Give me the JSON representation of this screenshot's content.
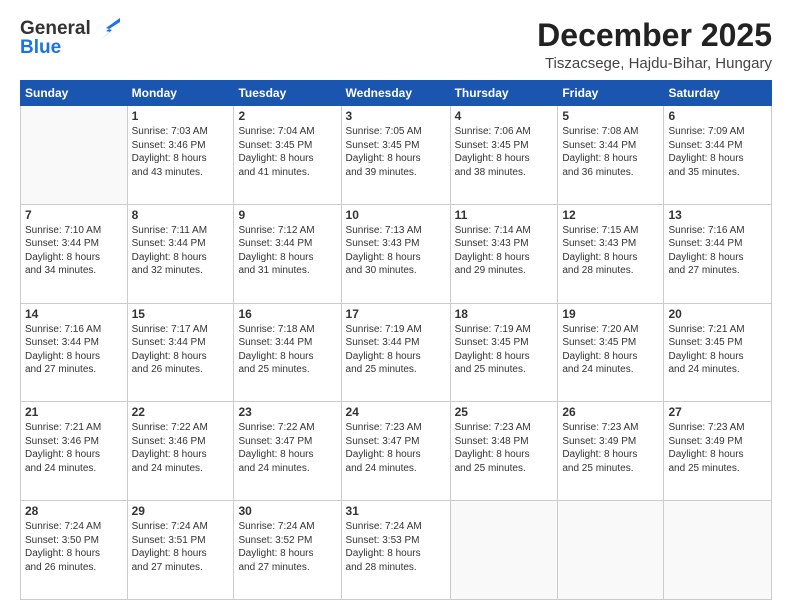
{
  "header": {
    "logo_line1": "General",
    "logo_line2": "Blue",
    "month": "December 2025",
    "location": "Tiszacsege, Hajdu-Bihar, Hungary"
  },
  "days_of_week": [
    "Sunday",
    "Monday",
    "Tuesday",
    "Wednesday",
    "Thursday",
    "Friday",
    "Saturday"
  ],
  "weeks": [
    [
      {
        "day": "",
        "sunrise": "",
        "sunset": "",
        "daylight": ""
      },
      {
        "day": "1",
        "sunrise": "Sunrise: 7:03 AM",
        "sunset": "Sunset: 3:46 PM",
        "daylight": "Daylight: 8 hours and 43 minutes."
      },
      {
        "day": "2",
        "sunrise": "Sunrise: 7:04 AM",
        "sunset": "Sunset: 3:45 PM",
        "daylight": "Daylight: 8 hours and 41 minutes."
      },
      {
        "day": "3",
        "sunrise": "Sunrise: 7:05 AM",
        "sunset": "Sunset: 3:45 PM",
        "daylight": "Daylight: 8 hours and 39 minutes."
      },
      {
        "day": "4",
        "sunrise": "Sunrise: 7:06 AM",
        "sunset": "Sunset: 3:45 PM",
        "daylight": "Daylight: 8 hours and 38 minutes."
      },
      {
        "day": "5",
        "sunrise": "Sunrise: 7:08 AM",
        "sunset": "Sunset: 3:44 PM",
        "daylight": "Daylight: 8 hours and 36 minutes."
      },
      {
        "day": "6",
        "sunrise": "Sunrise: 7:09 AM",
        "sunset": "Sunset: 3:44 PM",
        "daylight": "Daylight: 8 hours and 35 minutes."
      }
    ],
    [
      {
        "day": "7",
        "sunrise": "Sunrise: 7:10 AM",
        "sunset": "Sunset: 3:44 PM",
        "daylight": "Daylight: 8 hours and 34 minutes."
      },
      {
        "day": "8",
        "sunrise": "Sunrise: 7:11 AM",
        "sunset": "Sunset: 3:44 PM",
        "daylight": "Daylight: 8 hours and 32 minutes."
      },
      {
        "day": "9",
        "sunrise": "Sunrise: 7:12 AM",
        "sunset": "Sunset: 3:44 PM",
        "daylight": "Daylight: 8 hours and 31 minutes."
      },
      {
        "day": "10",
        "sunrise": "Sunrise: 7:13 AM",
        "sunset": "Sunset: 3:43 PM",
        "daylight": "Daylight: 8 hours and 30 minutes."
      },
      {
        "day": "11",
        "sunrise": "Sunrise: 7:14 AM",
        "sunset": "Sunset: 3:43 PM",
        "daylight": "Daylight: 8 hours and 29 minutes."
      },
      {
        "day": "12",
        "sunrise": "Sunrise: 7:15 AM",
        "sunset": "Sunset: 3:43 PM",
        "daylight": "Daylight: 8 hours and 28 minutes."
      },
      {
        "day": "13",
        "sunrise": "Sunrise: 7:16 AM",
        "sunset": "Sunset: 3:44 PM",
        "daylight": "Daylight: 8 hours and 27 minutes."
      }
    ],
    [
      {
        "day": "14",
        "sunrise": "Sunrise: 7:16 AM",
        "sunset": "Sunset: 3:44 PM",
        "daylight": "Daylight: 8 hours and 27 minutes."
      },
      {
        "day": "15",
        "sunrise": "Sunrise: 7:17 AM",
        "sunset": "Sunset: 3:44 PM",
        "daylight": "Daylight: 8 hours and 26 minutes."
      },
      {
        "day": "16",
        "sunrise": "Sunrise: 7:18 AM",
        "sunset": "Sunset: 3:44 PM",
        "daylight": "Daylight: 8 hours and 25 minutes."
      },
      {
        "day": "17",
        "sunrise": "Sunrise: 7:19 AM",
        "sunset": "Sunset: 3:44 PM",
        "daylight": "Daylight: 8 hours and 25 minutes."
      },
      {
        "day": "18",
        "sunrise": "Sunrise: 7:19 AM",
        "sunset": "Sunset: 3:45 PM",
        "daylight": "Daylight: 8 hours and 25 minutes."
      },
      {
        "day": "19",
        "sunrise": "Sunrise: 7:20 AM",
        "sunset": "Sunset: 3:45 PM",
        "daylight": "Daylight: 8 hours and 24 minutes."
      },
      {
        "day": "20",
        "sunrise": "Sunrise: 7:21 AM",
        "sunset": "Sunset: 3:45 PM",
        "daylight": "Daylight: 8 hours and 24 minutes."
      }
    ],
    [
      {
        "day": "21",
        "sunrise": "Sunrise: 7:21 AM",
        "sunset": "Sunset: 3:46 PM",
        "daylight": "Daylight: 8 hours and 24 minutes."
      },
      {
        "day": "22",
        "sunrise": "Sunrise: 7:22 AM",
        "sunset": "Sunset: 3:46 PM",
        "daylight": "Daylight: 8 hours and 24 minutes."
      },
      {
        "day": "23",
        "sunrise": "Sunrise: 7:22 AM",
        "sunset": "Sunset: 3:47 PM",
        "daylight": "Daylight: 8 hours and 24 minutes."
      },
      {
        "day": "24",
        "sunrise": "Sunrise: 7:23 AM",
        "sunset": "Sunset: 3:47 PM",
        "daylight": "Daylight: 8 hours and 24 minutes."
      },
      {
        "day": "25",
        "sunrise": "Sunrise: 7:23 AM",
        "sunset": "Sunset: 3:48 PM",
        "daylight": "Daylight: 8 hours and 25 minutes."
      },
      {
        "day": "26",
        "sunrise": "Sunrise: 7:23 AM",
        "sunset": "Sunset: 3:49 PM",
        "daylight": "Daylight: 8 hours and 25 minutes."
      },
      {
        "day": "27",
        "sunrise": "Sunrise: 7:23 AM",
        "sunset": "Sunset: 3:49 PM",
        "daylight": "Daylight: 8 hours and 25 minutes."
      }
    ],
    [
      {
        "day": "28",
        "sunrise": "Sunrise: 7:24 AM",
        "sunset": "Sunset: 3:50 PM",
        "daylight": "Daylight: 8 hours and 26 minutes."
      },
      {
        "day": "29",
        "sunrise": "Sunrise: 7:24 AM",
        "sunset": "Sunset: 3:51 PM",
        "daylight": "Daylight: 8 hours and 27 minutes."
      },
      {
        "day": "30",
        "sunrise": "Sunrise: 7:24 AM",
        "sunset": "Sunset: 3:52 PM",
        "daylight": "Daylight: 8 hours and 27 minutes."
      },
      {
        "day": "31",
        "sunrise": "Sunrise: 7:24 AM",
        "sunset": "Sunset: 3:53 PM",
        "daylight": "Daylight: 8 hours and 28 minutes."
      },
      {
        "day": "",
        "sunrise": "",
        "sunset": "",
        "daylight": ""
      },
      {
        "day": "",
        "sunrise": "",
        "sunset": "",
        "daylight": ""
      },
      {
        "day": "",
        "sunrise": "",
        "sunset": "",
        "daylight": ""
      }
    ]
  ]
}
